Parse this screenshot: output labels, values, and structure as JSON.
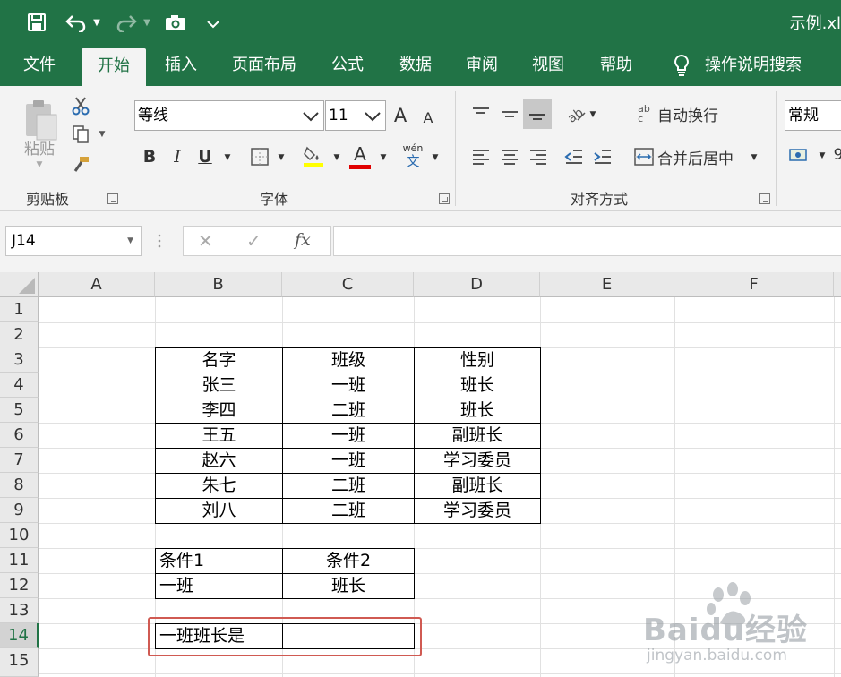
{
  "title_bar": {
    "document_title": "示例.xl",
    "qa_icons": [
      "save-icon",
      "undo-icon",
      "redo-icon",
      "camera-icon",
      "customize-icon"
    ]
  },
  "tabs": [
    {
      "label": "文件"
    },
    {
      "label": "开始",
      "active": true
    },
    {
      "label": "插入"
    },
    {
      "label": "页面布局"
    },
    {
      "label": "公式"
    },
    {
      "label": "数据"
    },
    {
      "label": "审阅"
    },
    {
      "label": "视图"
    },
    {
      "label": "帮助"
    },
    {
      "label": "操作说明搜索"
    }
  ],
  "ribbon": {
    "clipboard": {
      "paste_label": "粘贴",
      "group_label": "剪贴板"
    },
    "font": {
      "font_name": "等线",
      "font_size": "11",
      "grow": "A",
      "shrink": "A",
      "bold": "B",
      "italic": "I",
      "underline": "U",
      "font_color_letter": "A",
      "fill_color": "#ffff00",
      "font_color": "#e00000",
      "phonetic_top": "wén",
      "phonetic_bottom": "文",
      "group_label": "字体"
    },
    "alignment": {
      "wrap_text": "自动换行",
      "wrap_icon_text": "ab\nc",
      "merge_center": "合并后居中",
      "group_label": "对齐方式"
    },
    "number": {
      "format": "常规",
      "partial": "9"
    }
  },
  "formula_bar": {
    "name_box": "J14",
    "cancel": "✕",
    "enter": "✓",
    "fx": "fx",
    "formula": ""
  },
  "sheet": {
    "columns": [
      "A",
      "B",
      "C",
      "D",
      "E",
      "F"
    ],
    "rows": [
      "1",
      "2",
      "3",
      "4",
      "5",
      "6",
      "7",
      "8",
      "9",
      "10",
      "11",
      "12",
      "13",
      "14",
      "15"
    ],
    "selected_row": "14",
    "table": {
      "headers": [
        "名字",
        "班级",
        "性别"
      ],
      "rows": [
        [
          "张三",
          "一班",
          "班长"
        ],
        [
          "李四",
          "二班",
          "班长"
        ],
        [
          "王五",
          "一班",
          "副班长"
        ],
        [
          "赵六",
          "一班",
          "学习委员"
        ],
        [
          "朱七",
          "二班",
          "副班长"
        ],
        [
          "刘八",
          "二班",
          "学习委员"
        ]
      ]
    },
    "conditions": {
      "label1": "条件1",
      "label2": "条件2",
      "value1": "一班",
      "value2": "班长"
    },
    "result_label": "一班班长是",
    "result_value": ""
  },
  "watermark": {
    "brand": "Baidu经验",
    "url": "jingyan.baidu.com"
  },
  "colors": {
    "excel_green": "#217346",
    "highlight_red": "#d05a52"
  }
}
